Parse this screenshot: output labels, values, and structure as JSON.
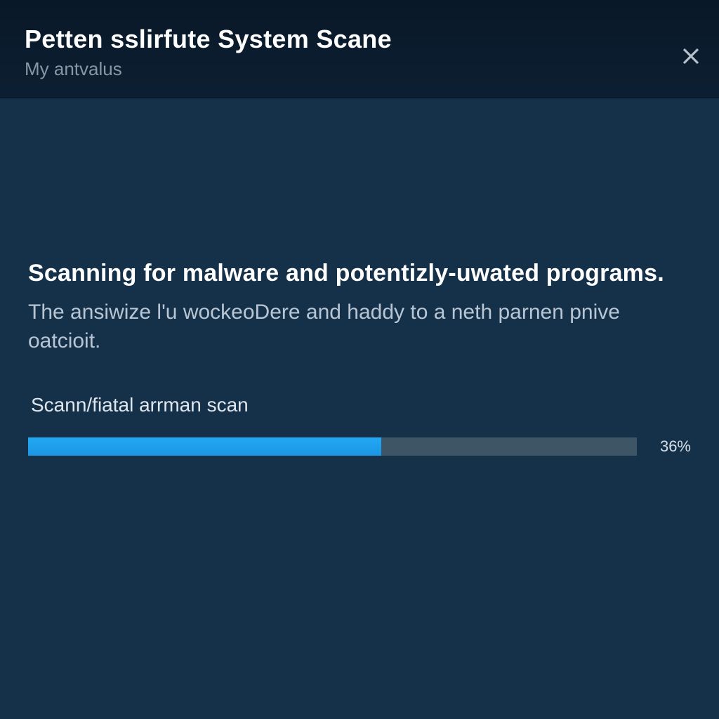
{
  "header": {
    "title": "Petten sslirfute System Scane",
    "subtitle": "My antvalus"
  },
  "main": {
    "heading": "Scanning for malware and potentizly-uwated programs.",
    "description": "The ansiwize l'u wockeoDere and haddy to a neth parnen pnive oatcioit.",
    "scan_label": "Scann/fiatal arrman scan",
    "progress_percent_label": "36%",
    "progress_fill_percent": 58
  },
  "colors": {
    "background": "#15314a",
    "header_bg": "#0a1a2a",
    "progress_track": "#3e5566",
    "progress_fill": "#1fa0ee"
  }
}
